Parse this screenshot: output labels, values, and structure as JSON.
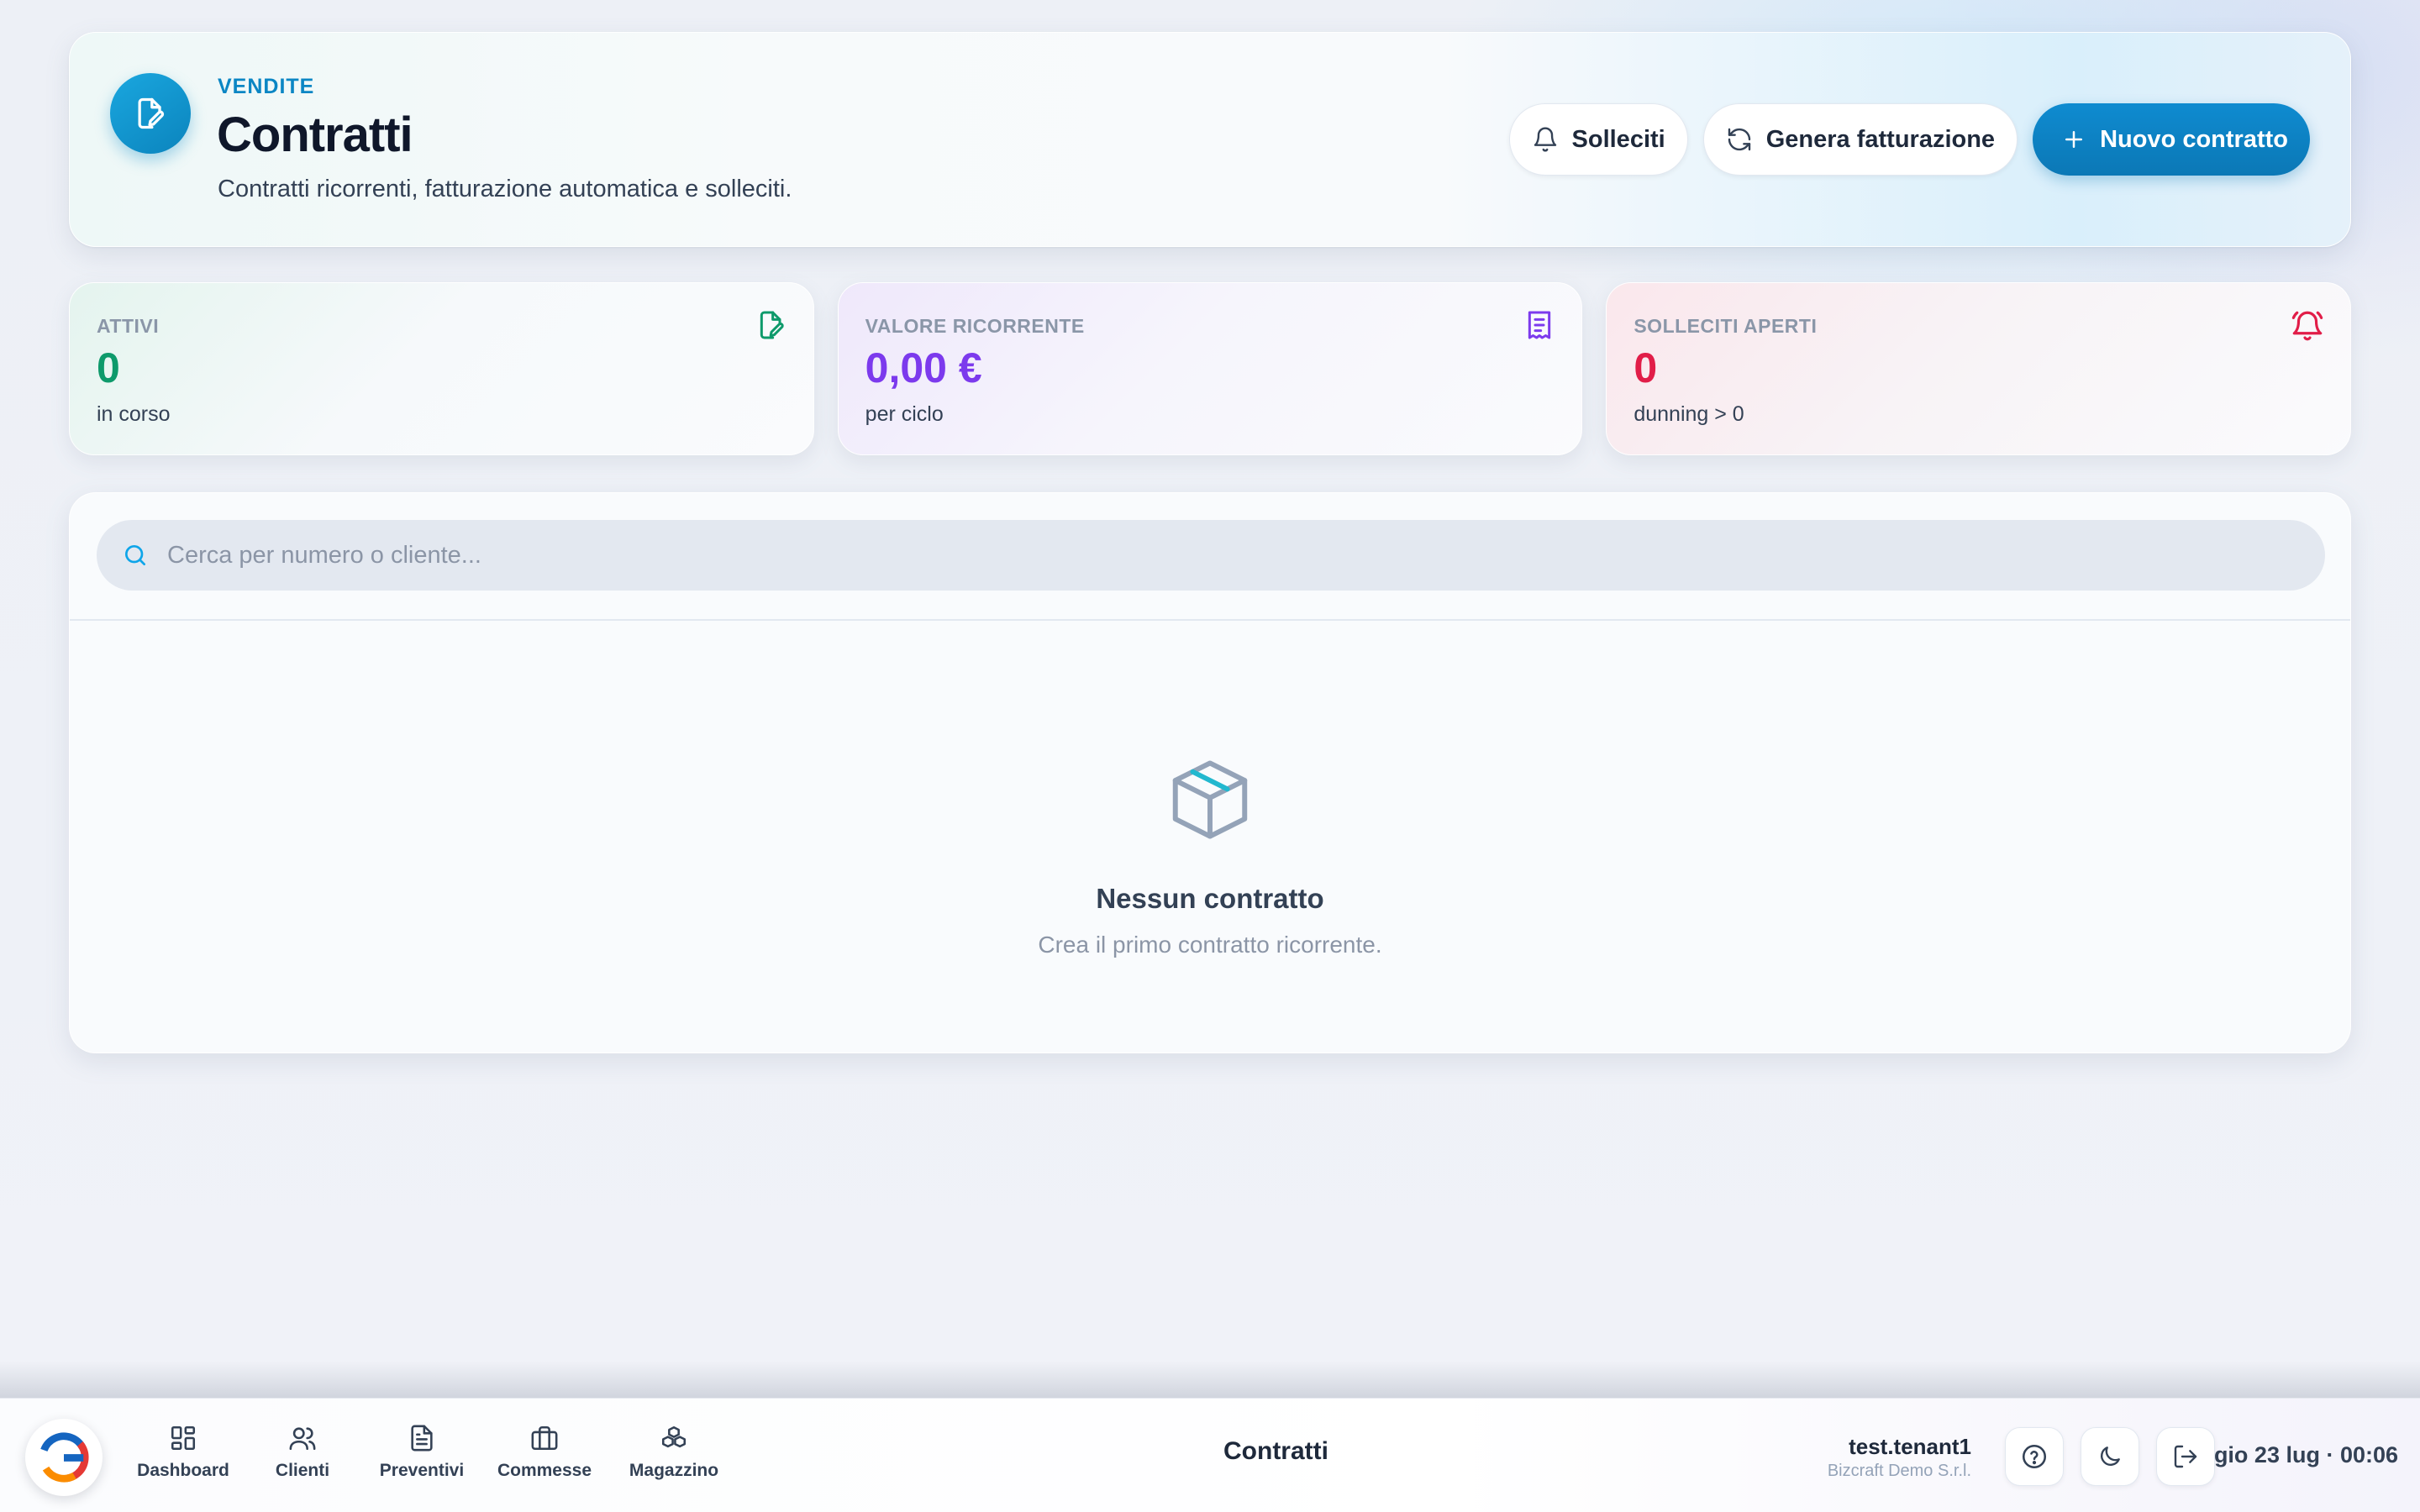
{
  "header": {
    "eyebrow": "VENDITE",
    "title": "Contratti",
    "subtitle": "Contratti ricorrenti, fatturazione automatica e solleciti.",
    "actions": {
      "reminders_label": "Solleciti",
      "billing_label": "Genera fatturazione",
      "new_label": "Nuovo contratto"
    }
  },
  "stats": [
    {
      "label": "ATTIVI",
      "value": "0",
      "note": "in corso",
      "icon": "contract-edit-icon",
      "color": "#0e9a6b"
    },
    {
      "label": "VALORE RICORRENTE",
      "value": "0,00 €",
      "note": "per ciclo",
      "icon": "receipt-icon",
      "color": "#7c3aed"
    },
    {
      "label": "SOLLECITI APERTI",
      "value": "0",
      "note": "dunning > 0",
      "icon": "bell-ring-icon",
      "color": "#e11d48"
    }
  ],
  "search": {
    "placeholder": "Cerca per numero o cliente...",
    "value": ""
  },
  "empty_state": {
    "title": "Nessun contratto",
    "subtitle": "Crea il primo contratto ricorrente."
  },
  "dock": {
    "nav": [
      {
        "label": "Dashboard",
        "icon": "grid-icon"
      },
      {
        "label": "Clienti",
        "icon": "users-icon"
      },
      {
        "label": "Preventivi",
        "icon": "document-icon"
      },
      {
        "label": "Commesse",
        "icon": "briefcase-icon"
      },
      {
        "label": "Magazzino",
        "icon": "boxes-icon"
      }
    ],
    "current_page": "Contratti",
    "user": {
      "name": "test.tenant1",
      "company": "Bizcraft Demo S.r.l."
    },
    "date": "gio 23 lug · 00:06"
  },
  "colors": {
    "accent": "#0b86c4",
    "primary_button": "#0b78b6",
    "green": "#0e9a6b",
    "purple": "#7c3aed",
    "red": "#e11d48"
  }
}
